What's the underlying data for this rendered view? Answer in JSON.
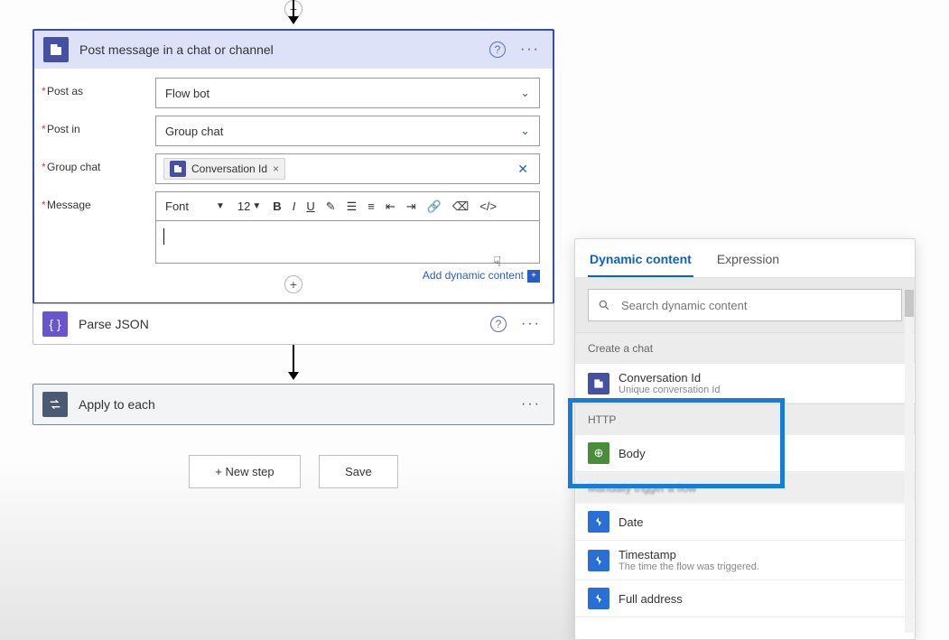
{
  "teams_action": {
    "title": "Post message in a chat or channel",
    "field_post_as": {
      "label": "Post as",
      "value": "Flow bot"
    },
    "field_post_in": {
      "label": "Post in",
      "value": "Group chat"
    },
    "field_group_chat": {
      "label": "Group chat",
      "token": "Conversation Id"
    },
    "field_message": {
      "label": "Message"
    },
    "rte": {
      "font": "Font",
      "size": "12"
    },
    "add_dynamic": "Add dynamic content"
  },
  "json_action": {
    "title": "Parse JSON"
  },
  "apply_action": {
    "title": "Apply to each"
  },
  "buttons": {
    "new_step": "+ New step",
    "save": "Save"
  },
  "panel": {
    "tab_dynamic": "Dynamic content",
    "tab_expression": "Expression",
    "search_placeholder": "Search dynamic content",
    "group_create_chat": "Create a chat",
    "item_conv_id": {
      "label": "Conversation Id",
      "desc": "Unique conversation Id"
    },
    "group_http": "HTTP",
    "item_body": {
      "label": "Body"
    },
    "group_trigger": "Manually trigger a flow",
    "item_date": {
      "label": "Date"
    },
    "item_ts": {
      "label": "Timestamp",
      "desc": "The time the flow was triggered."
    },
    "item_addr": {
      "label": "Full address"
    }
  }
}
